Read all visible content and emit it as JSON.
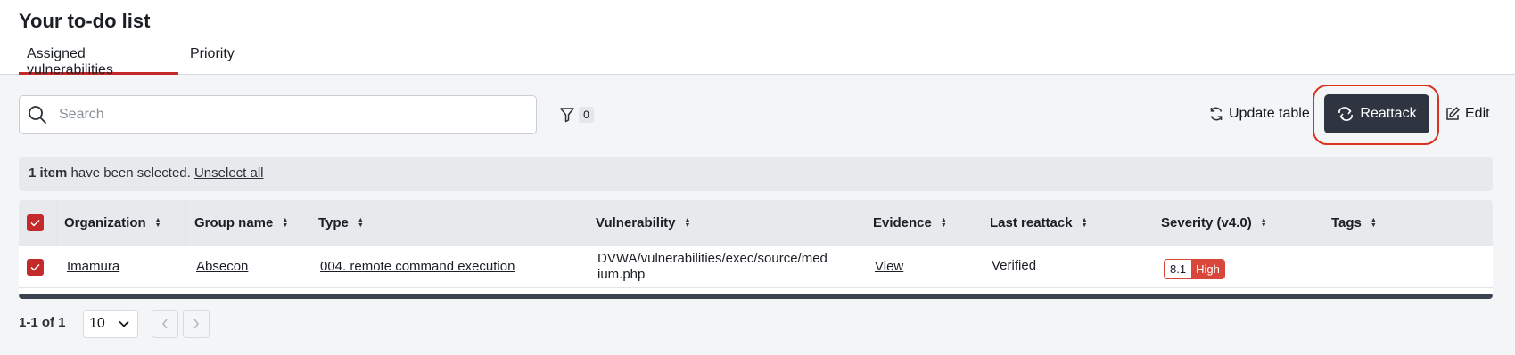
{
  "page": {
    "title": "Your to-do list"
  },
  "tabs": [
    {
      "label": "Assigned vulnerabilities",
      "active": true
    },
    {
      "label": "Priority",
      "active": false
    }
  ],
  "toolbar": {
    "search_placeholder": "Search",
    "filter_count": "0",
    "update_label": "Update table",
    "reattack_label": "Reattack",
    "edit_label": "Edit"
  },
  "selection": {
    "count_text": "1 item",
    "rest_text": " have been selected. ",
    "unselect_label": "Unselect all"
  },
  "table": {
    "columns": [
      "Organization",
      "Group name",
      "Type",
      "Vulnerability",
      "Evidence",
      "Last reattack",
      "Severity (v4.0)",
      "Tags"
    ],
    "rows": [
      {
        "selected": true,
        "organization": "Imamura",
        "group": "Absecon",
        "type": "004. remote command execution",
        "vulnerability_line1": "DVWA/vulnerabilities/exec/source/med",
        "vulnerability_line2": "ium.php",
        "evidence": "View",
        "last_reattack": "Verified",
        "severity_score": "8.1",
        "severity_level": "High",
        "tags": ""
      }
    ]
  },
  "pagination": {
    "range_text": "1-1 of 1",
    "per_page": "10"
  },
  "colors": {
    "accent": "#c52a2a",
    "primary_button": "#2e3440",
    "highlight_ring": "#d9331f",
    "severity_high": "#d9463a"
  }
}
